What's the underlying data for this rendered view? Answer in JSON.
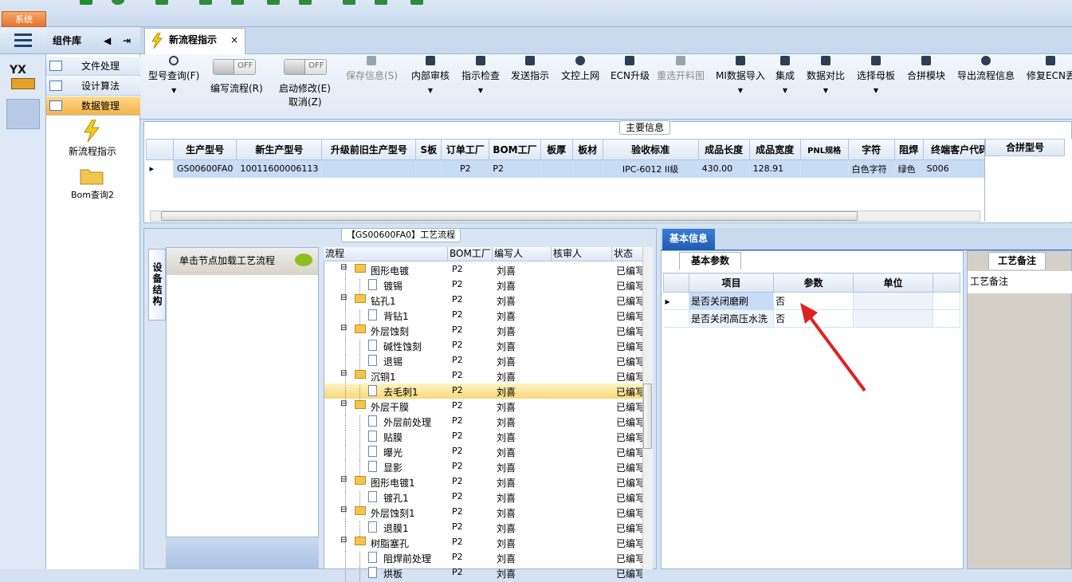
{
  "system_tab": "系统",
  "components": {
    "title": "组件库",
    "items": [
      {
        "label": "文件处理"
      },
      {
        "label": "设计算法"
      },
      {
        "label": "数据管理"
      }
    ],
    "tools": [
      {
        "label": "新流程指示"
      },
      {
        "label": "Bom查询2"
      }
    ]
  },
  "tab": {
    "title": "新流程指示",
    "close": "×"
  },
  "toolbar": {
    "model_query": "型号查询(F)",
    "edit_flow": "编写流程(R)",
    "enable_edit": "启动修改(E)",
    "cancel": "取消(Z)",
    "toggle_off": "OFF",
    "save_info": "保存信息(S)",
    "internal_review": "内部审核",
    "indication_check": "指示检查",
    "send_indication": "发送指示",
    "upload_doc": "文控上网",
    "ecn_upgrade": "ECN升级",
    "reselect_map": "重选开料图",
    "mi_import": "MI数据导入",
    "integrate": "集成",
    "data_compare": "数据对比",
    "select_mother": "选择母板",
    "merge_module": "合拼模块",
    "export_flow": "导出流程信息",
    "repair_ecn": "修复ECN丢"
  },
  "main_info": {
    "title": "主要信息",
    "columns": [
      "生产型号",
      "新生产型号",
      "升级前旧生产型号",
      "S板",
      "订单工厂",
      "BOM工厂",
      "板厚",
      "板材",
      "验收标准",
      "成品长度",
      "成品宽度",
      "PNL规格",
      "字符",
      "阻焊",
      "终端客户代码"
    ],
    "row": [
      "GS00600FA0",
      "10011600006113",
      "",
      "",
      "P2",
      "P2",
      "",
      "",
      "IPC-6012 II级",
      "430.00",
      "128.91",
      "",
      "白色字符",
      "绿色",
      "S006"
    ],
    "right_header": "合拼型号"
  },
  "process": {
    "title": "【GS00600FA0】工艺流程",
    "side_tab": "设备结构",
    "load_btn": "单击节点加载工艺流程",
    "columns": [
      "流程",
      "BOM工厂",
      "编写人",
      "核审人",
      "状态"
    ],
    "rows": [
      {
        "name": "图形电镀",
        "level": 1,
        "bom": "P2",
        "writer": "刘喜",
        "status": "已编写"
      },
      {
        "name": "镀锡",
        "level": 2,
        "bom": "P2",
        "writer": "刘喜",
        "status": "已编写"
      },
      {
        "name": "钻孔1",
        "level": 1,
        "bom": "P2",
        "writer": "刘喜",
        "status": "已编写"
      },
      {
        "name": "背钻1",
        "level": 2,
        "bom": "P2",
        "writer": "刘喜",
        "status": "已编写"
      },
      {
        "name": "外层蚀刻",
        "level": 1,
        "bom": "P2",
        "writer": "刘喜",
        "status": "已编写"
      },
      {
        "name": "碱性蚀刻",
        "level": 2,
        "bom": "P2",
        "writer": "刘喜",
        "status": "已编写"
      },
      {
        "name": "退锡",
        "level": 2,
        "bom": "P2",
        "writer": "刘喜",
        "status": "已编写"
      },
      {
        "name": "沉铜1",
        "level": 1,
        "bom": "P2",
        "writer": "刘喜",
        "status": "已编写"
      },
      {
        "name": "去毛刺1",
        "level": 2,
        "bom": "P2",
        "writer": "刘喜",
        "status": "已编写"
      },
      {
        "name": "外层干膜",
        "level": 1,
        "bom": "P2",
        "writer": "刘喜",
        "status": "已编写"
      },
      {
        "name": "外层前处理",
        "level": 2,
        "bom": "P2",
        "writer": "刘喜",
        "status": "已编写"
      },
      {
        "name": "贴膜",
        "level": 2,
        "bom": "P2",
        "writer": "刘喜",
        "status": "已编写"
      },
      {
        "name": "曝光",
        "level": 2,
        "bom": "P2",
        "writer": "刘喜",
        "status": "已编写"
      },
      {
        "name": "显影",
        "level": 2,
        "bom": "P2",
        "writer": "刘喜",
        "status": "已编写"
      },
      {
        "name": "图形电镀1",
        "level": 1,
        "bom": "P2",
        "writer": "刘喜",
        "status": "已编写"
      },
      {
        "name": "镀孔1",
        "level": 2,
        "bom": "P2",
        "writer": "刘喜",
        "status": "已编写"
      },
      {
        "name": "外层蚀刻1",
        "level": 1,
        "bom": "P2",
        "writer": "刘喜",
        "status": "已编写"
      },
      {
        "name": "退膜1",
        "level": 2,
        "bom": "P2",
        "writer": "刘喜",
        "status": "已编写"
      },
      {
        "name": "树脂塞孔",
        "level": 1,
        "bom": "P2",
        "writer": "刘喜",
        "status": "已编写"
      },
      {
        "name": "阻焊前处理",
        "level": 2,
        "bom": "P2",
        "writer": "刘喜",
        "status": "已编写"
      },
      {
        "name": "烘板",
        "level": 2,
        "bom": "P2",
        "writer": "刘喜",
        "status": "已编写"
      }
    ]
  },
  "basic_info": {
    "tab": "基本信息",
    "params_tab": "基本参数",
    "columns": [
      "项目",
      "参数",
      "单位"
    ],
    "rows": [
      {
        "item": "是否关闭磨刷",
        "value": "否",
        "unit": ""
      },
      {
        "item": "是否关闭高压水洗",
        "value": "否",
        "unit": ""
      }
    ],
    "notes_tab": "工艺备注",
    "notes_label": "工艺备注"
  },
  "colors": {
    "accent": "#2b6cc4",
    "selection": "#f9d87a",
    "annotation_arrow": "#e02020"
  }
}
